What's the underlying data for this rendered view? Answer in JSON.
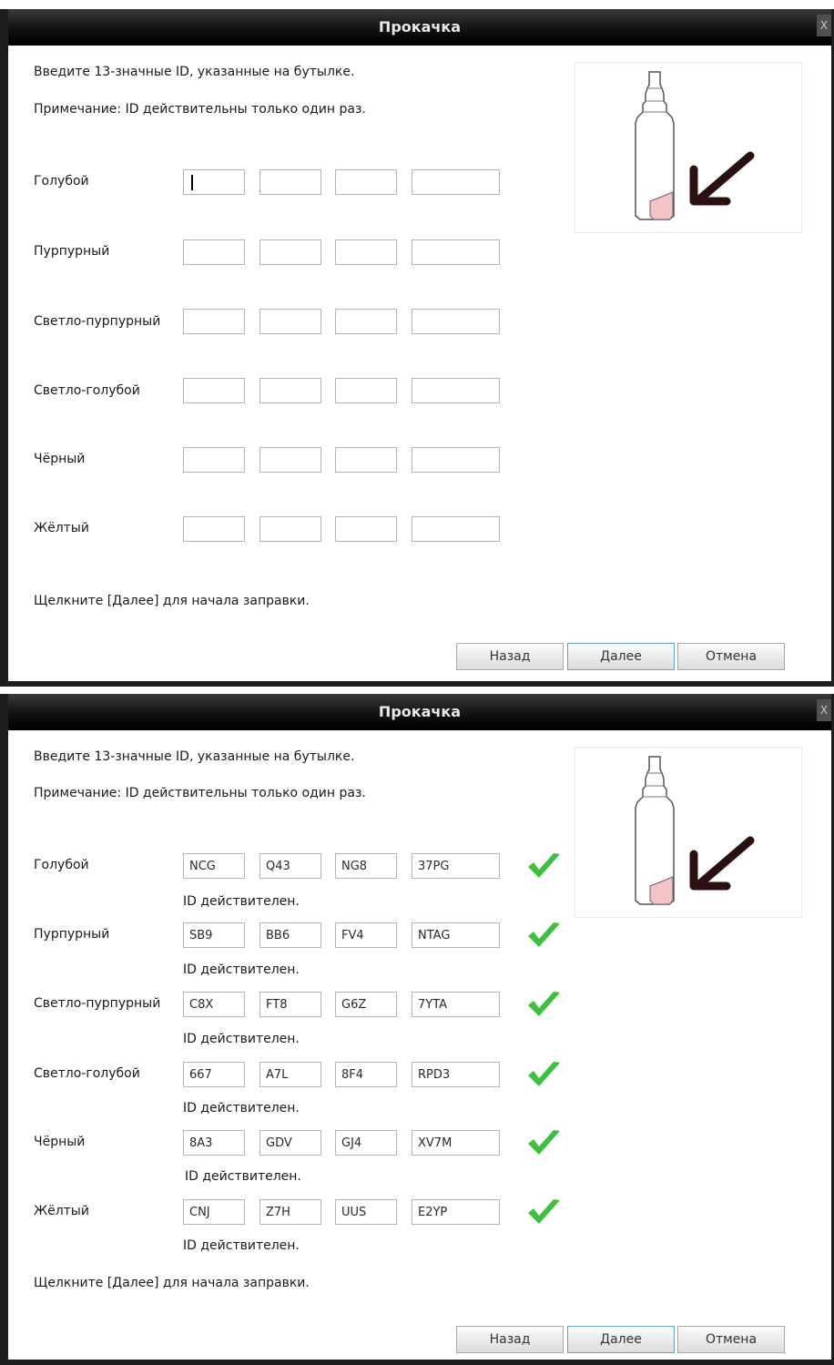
{
  "dialog_title": "Прокачка",
  "close_label": "X",
  "instruction": "Введите 13-значные ID, указанные на бутылке.",
  "note": "Примечание: ID действительны только один раз.",
  "footer": "Щелкните [Далее] для начала заправки.",
  "buttons": {
    "back": "Назад",
    "next": "Далее",
    "cancel": "Отмена"
  },
  "valid_text": "ID действителен.",
  "inks": [
    {
      "label": "Голубой",
      "codes": [
        "NCG",
        "Q43",
        "NG8",
        "37PG"
      ]
    },
    {
      "label": "Пурпурный",
      "codes": [
        "SB9",
        "BB6",
        "FV4",
        "NTAG"
      ]
    },
    {
      "label": "Светло-пурпурный",
      "codes": [
        "C8X",
        "FT8",
        "G6Z",
        "7YTA"
      ]
    },
    {
      "label": "Светло-голубой",
      "codes": [
        "667",
        "A7L",
        "8F4",
        "RPD3"
      ]
    },
    {
      "label": "Чёрный",
      "codes": [
        "8A3",
        "GDV",
        "GJ4",
        "XV7M"
      ]
    },
    {
      "label": "Жёлтый",
      "codes": [
        "CNJ",
        "Z7H",
        "UUS",
        "E2YP"
      ]
    }
  ],
  "icons": {
    "bottle": "ink-bottle-illustration",
    "arrow": "arrow-icon",
    "check": "checkmark-icon"
  },
  "colors": {
    "check": "#3fbf3f",
    "bottle_ink": "#f3c3c6",
    "arrow": "#2a1010",
    "titlebar": "#151515"
  }
}
